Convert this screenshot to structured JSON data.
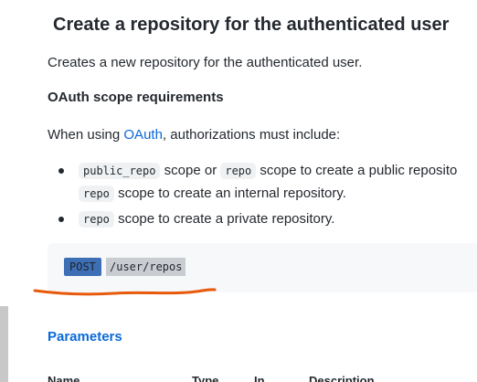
{
  "section": {
    "title": "Create a repository for the authenticated user",
    "description": "Creates a new repository for the authenticated user.",
    "oauth_heading": "OAuth scope requirements",
    "when_prefix": "When using ",
    "oauth_link": "OAuth",
    "when_suffix": ", authorizations must include:"
  },
  "requirements": [
    {
      "code1": "public_repo",
      "mid": " scope or ",
      "code2": "repo",
      "end": " scope to create a public reposito",
      "line2_code": "repo",
      "line2_text": " scope to create an internal repository."
    },
    {
      "code1": "repo",
      "end": " scope to create a private repository."
    }
  ],
  "endpoint": {
    "method": "POST",
    "path": "/user/repos"
  },
  "parameters": {
    "heading": "Parameters",
    "columns": [
      "Name",
      "Type",
      "In",
      "Description"
    ]
  },
  "colors": {
    "link": "#0969da",
    "annotation": "#e8590c",
    "method_highlight": "#3d6fb6"
  }
}
